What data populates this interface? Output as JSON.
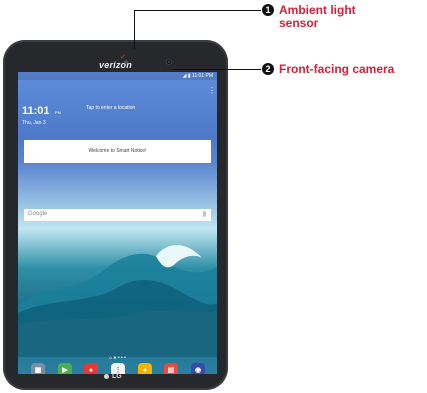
{
  "callouts": [
    {
      "number": "1",
      "text": "Ambient light sensor"
    },
    {
      "number": "2",
      "text": "Front-facing camera"
    }
  ],
  "device": {
    "brand": "verizon",
    "status_icons": "◢ ▮ 11:01 PM",
    "clock": {
      "time": "11:01",
      "ampm": "PM",
      "date": "Thu, Jan 3"
    },
    "weather_text": "Tap to enter a location",
    "smart_notice": "Welcome to Smart Notice!",
    "search": {
      "placeholder": "Google",
      "mic_icon": "microphone-icon"
    },
    "page_indicator": "⌂ ● • • •",
    "dock_apps": [
      {
        "name": "folder-icon",
        "color": "#7c8fa2",
        "symbol": "▦"
      },
      {
        "name": "play-store-icon",
        "color": "#4caf50",
        "symbol": "▶"
      },
      {
        "name": "chrome-icon",
        "color": "#e53935",
        "symbol": "●"
      },
      {
        "name": "apps-icon",
        "color": "#f1f3f4",
        "symbol": "⋮"
      },
      {
        "name": "messaging-icon",
        "color": "#f4b400",
        "symbol": "●"
      },
      {
        "name": "verizon-app-icon",
        "color": "#e74c3c",
        "symbol": "▤"
      },
      {
        "name": "camera-app-icon",
        "color": "#3949ab",
        "symbol": "◉"
      }
    ],
    "navigation": {
      "back": "◁",
      "home": "○",
      "recents": "□"
    },
    "manufacturer": "LG"
  }
}
